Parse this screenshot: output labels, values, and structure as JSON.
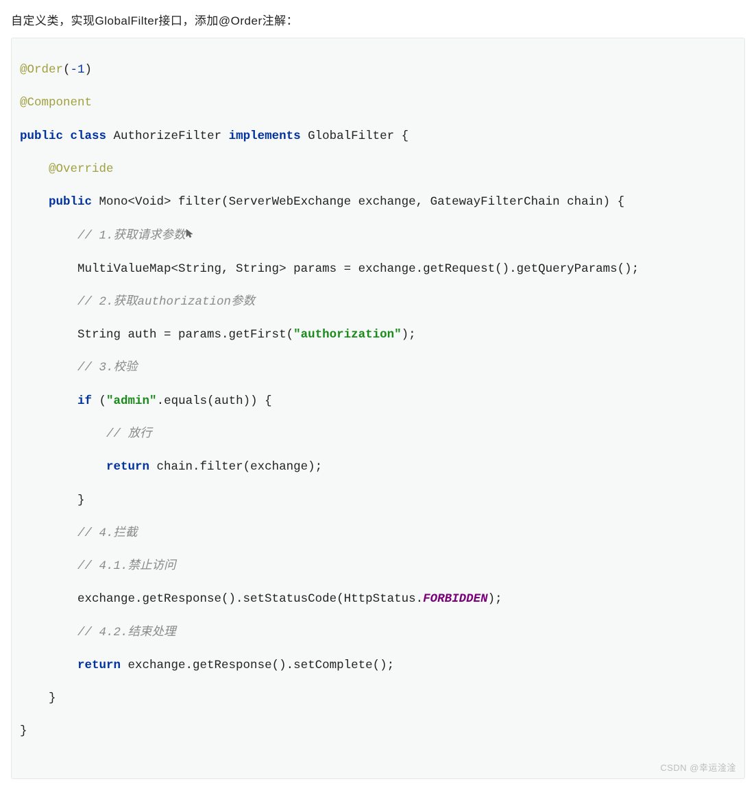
{
  "description": "自定义类，实现GlobalFilter接口，添加@Order注解：",
  "code": {
    "l1_annotation1": "@Order",
    "l1_paren_open": "(",
    "l1_num": "-1",
    "l1_paren_close": ")",
    "l2_annotation": "@Component",
    "l3_kw1": "public",
    "l3_kw2": "class",
    "l3_name": " AuthorizeFilter ",
    "l3_kw3": "implements",
    "l3_impl": " GlobalFilter {",
    "l4_annotation": "@Override",
    "l5_kw1": "public",
    "l5_sig": " Mono<Void> filter(ServerWebExchange exchange, GatewayFilterChain chain) {",
    "l6_comment": "// 1.获取请求参数",
    "l7_text": "MultiValueMap<String, String> params = exchange.getRequest().getQueryParams();",
    "l8_comment": "// 2.获取authorization参数",
    "l9_text_a": "String auth = params.getFirst(",
    "l9_str": "\"authorization\"",
    "l9_text_b": ");",
    "l10_comment": "// 3.校验",
    "l11_kw": "if",
    "l11_a": " (",
    "l11_str": "\"admin\"",
    "l11_b": ".equals(auth)) {",
    "l12_comment": "// 放行",
    "l13_kw": "return",
    "l13_text": " chain.filter(exchange);",
    "l14_brace": "}",
    "l15_comment": "// 4.拦截",
    "l16_comment": "// 4.1.禁止访问",
    "l17_a": "exchange.getResponse().setStatusCode(HttpStatus.",
    "l17_const": "FORBIDDEN",
    "l17_b": ");",
    "l18_comment": "// 4.2.结束处理",
    "l19_kw": "return",
    "l19_text": " exchange.getResponse().setComplete();",
    "l20_brace": "}",
    "l21_brace": "}"
  },
  "watermark": "CSDN @幸运淦淦",
  "indent": {
    "i1": "    ",
    "i2": "        ",
    "i3": "            "
  }
}
